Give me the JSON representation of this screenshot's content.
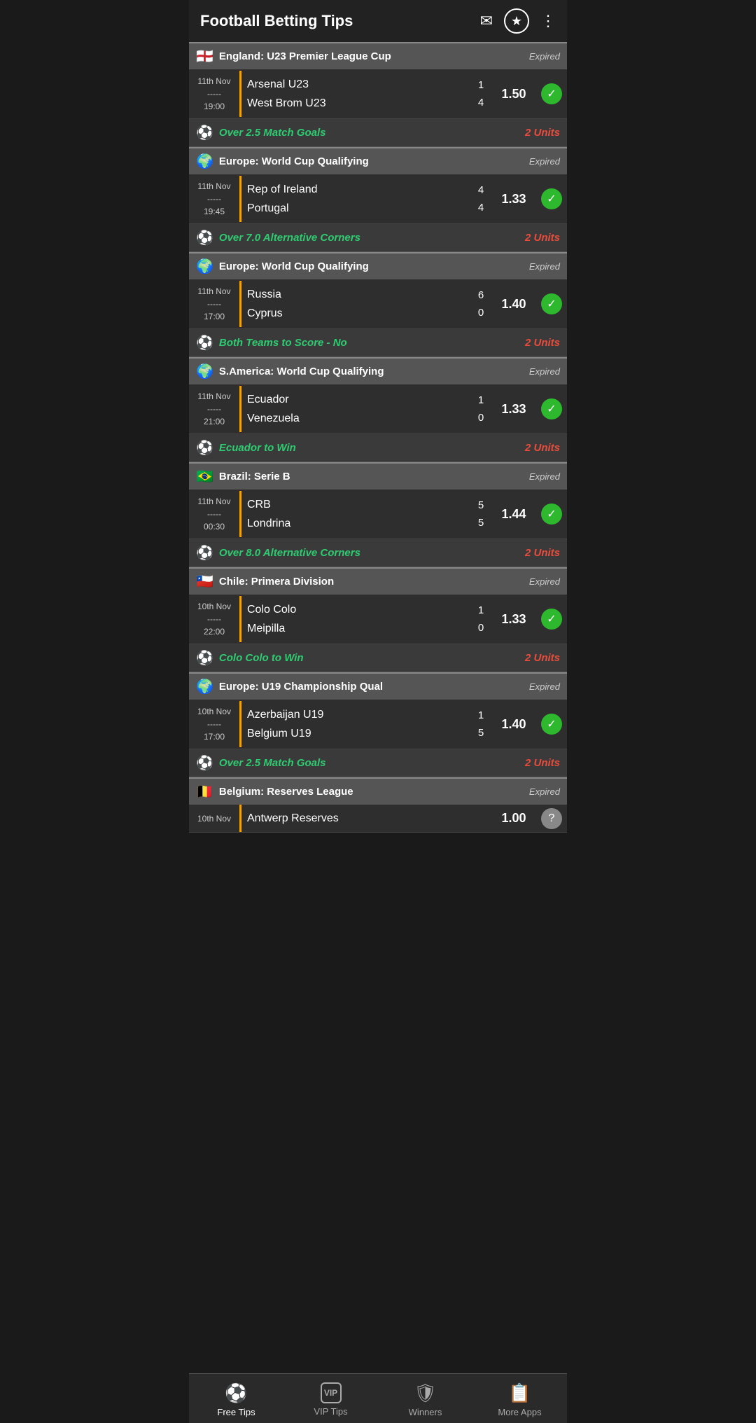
{
  "header": {
    "title": "Football Betting Tips"
  },
  "matches": [
    {
      "league": "England: U23 Premier League Cup",
      "flag": "🏴󠁧󠁢󠁥󠁮󠁧󠁿",
      "status": "Expired",
      "date": "11th Nov\n-----\n19:00",
      "team1": "Arsenal U23",
      "team2": "West Brom U23",
      "score1": "1",
      "score2": "4",
      "odds": "1.50",
      "result": "win",
      "tip": "Over 2.5 Match Goals",
      "units": "2 Units"
    },
    {
      "league": "Europe: World Cup Qualifying",
      "flag": "🌍",
      "status": "Expired",
      "date": "11th Nov\n-----\n19:45",
      "team1": "Rep of Ireland",
      "team2": "Portugal",
      "score1": "4",
      "score2": "4",
      "odds": "1.33",
      "result": "win",
      "tip": "Over 7.0 Alternative Corners",
      "units": "2 Units"
    },
    {
      "league": "Europe: World Cup Qualifying",
      "flag": "🌍",
      "status": "Expired",
      "date": "11th Nov\n-----\n17:00",
      "team1": "Russia",
      "team2": "Cyprus",
      "score1": "6",
      "score2": "0",
      "odds": "1.40",
      "result": "win",
      "tip": "Both Teams to Score - No",
      "units": "2 Units"
    },
    {
      "league": "S.America: World Cup Qualifying",
      "flag": "🌍",
      "status": "Expired",
      "date": "11th Nov\n-----\n21:00",
      "team1": "Ecuador",
      "team2": "Venezuela",
      "score1": "1",
      "score2": "0",
      "odds": "1.33",
      "result": "win",
      "tip": "Ecuador to Win",
      "units": "2 Units"
    },
    {
      "league": "Brazil: Serie B",
      "flag": "🇧🇷",
      "status": "Expired",
      "date": "11th Nov\n-----\n00:30",
      "team1": "CRB",
      "team2": "Londrina",
      "score1": "5",
      "score2": "5",
      "odds": "1.44",
      "result": "win",
      "tip": "Over 8.0 Alternative Corners",
      "units": "2 Units"
    },
    {
      "league": "Chile: Primera Division",
      "flag": "🇨🇱",
      "status": "Expired",
      "date": "10th Nov\n-----\n22:00",
      "team1": "Colo Colo",
      "team2": "Meipilla",
      "score1": "1",
      "score2": "0",
      "odds": "1.33",
      "result": "win",
      "tip": "Colo Colo to Win",
      "units": "2 Units"
    },
    {
      "league": "Europe: U19 Championship Qual",
      "flag": "🌍",
      "status": "Expired",
      "date": "10th Nov\n-----\n17:00",
      "team1": "Azerbaijan U19",
      "team2": "Belgium U19",
      "score1": "1",
      "score2": "5",
      "odds": "1.40",
      "result": "win",
      "tip": "Over 2.5 Match Goals",
      "units": "2 Units"
    },
    {
      "league": "Belgium: Reserves League",
      "flag": "🇧🇪",
      "status": "Expired",
      "date": "10th Nov",
      "team1": "Antwerp Reserves",
      "team2": "",
      "score1": "",
      "score2": "",
      "odds": "1.00",
      "result": "pending",
      "tip": "",
      "units": ""
    }
  ],
  "nav": {
    "items": [
      {
        "id": "free-tips",
        "label": "Free Tips",
        "icon": "⚽",
        "active": true
      },
      {
        "id": "vip-tips",
        "label": "VIP Tips",
        "icon": "VIP",
        "active": false
      },
      {
        "id": "winners",
        "label": "Winners",
        "icon": "🛡",
        "active": false
      },
      {
        "id": "more-apps",
        "label": "More Apps",
        "icon": "📋",
        "active": false
      }
    ]
  }
}
